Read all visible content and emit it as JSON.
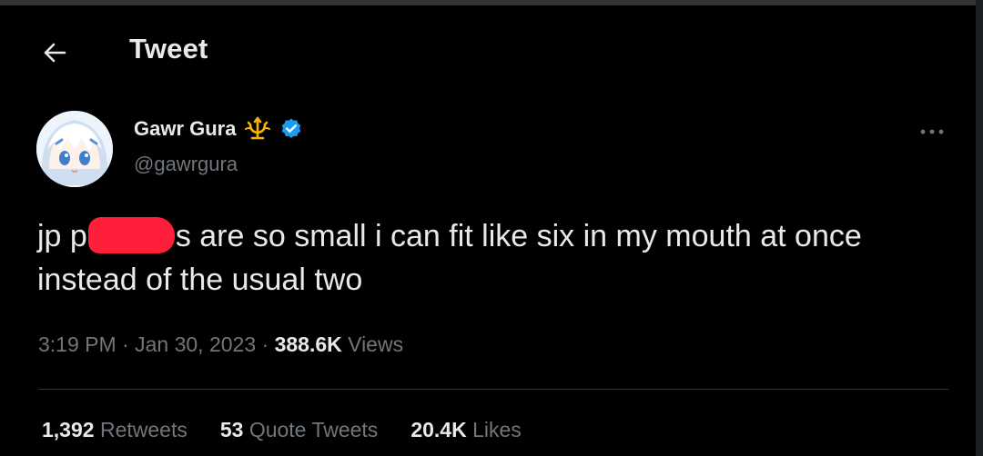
{
  "header": {
    "title": "Tweet"
  },
  "author": {
    "display_name": "Gawr Gura",
    "handle": "@gawrgura"
  },
  "tweet": {
    "text_start": "jp p",
    "text_rest": "s are so small i can fit like six in my mouth at once instead of the usual two"
  },
  "meta": {
    "time": "3:19 PM",
    "date": "Jan 30, 2023",
    "views_count": "388.6K",
    "views_label": "Views"
  },
  "stats": {
    "retweets_count": "1,392",
    "retweets_label": "Retweets",
    "quotes_count": "53",
    "quotes_label": "Quote Tweets",
    "likes_count": "20.4K",
    "likes_label": "Likes"
  },
  "colors": {
    "background": "#000000",
    "text_primary": "#e7e9ea",
    "text_secondary": "#71767b",
    "verified": "#1d9bf0",
    "affiliate_badge": "#f4b400",
    "redaction": "#ff1f3a"
  },
  "icons": [
    "back-arrow-icon",
    "trident-icon",
    "verified-badge-icon",
    "more-icon"
  ]
}
